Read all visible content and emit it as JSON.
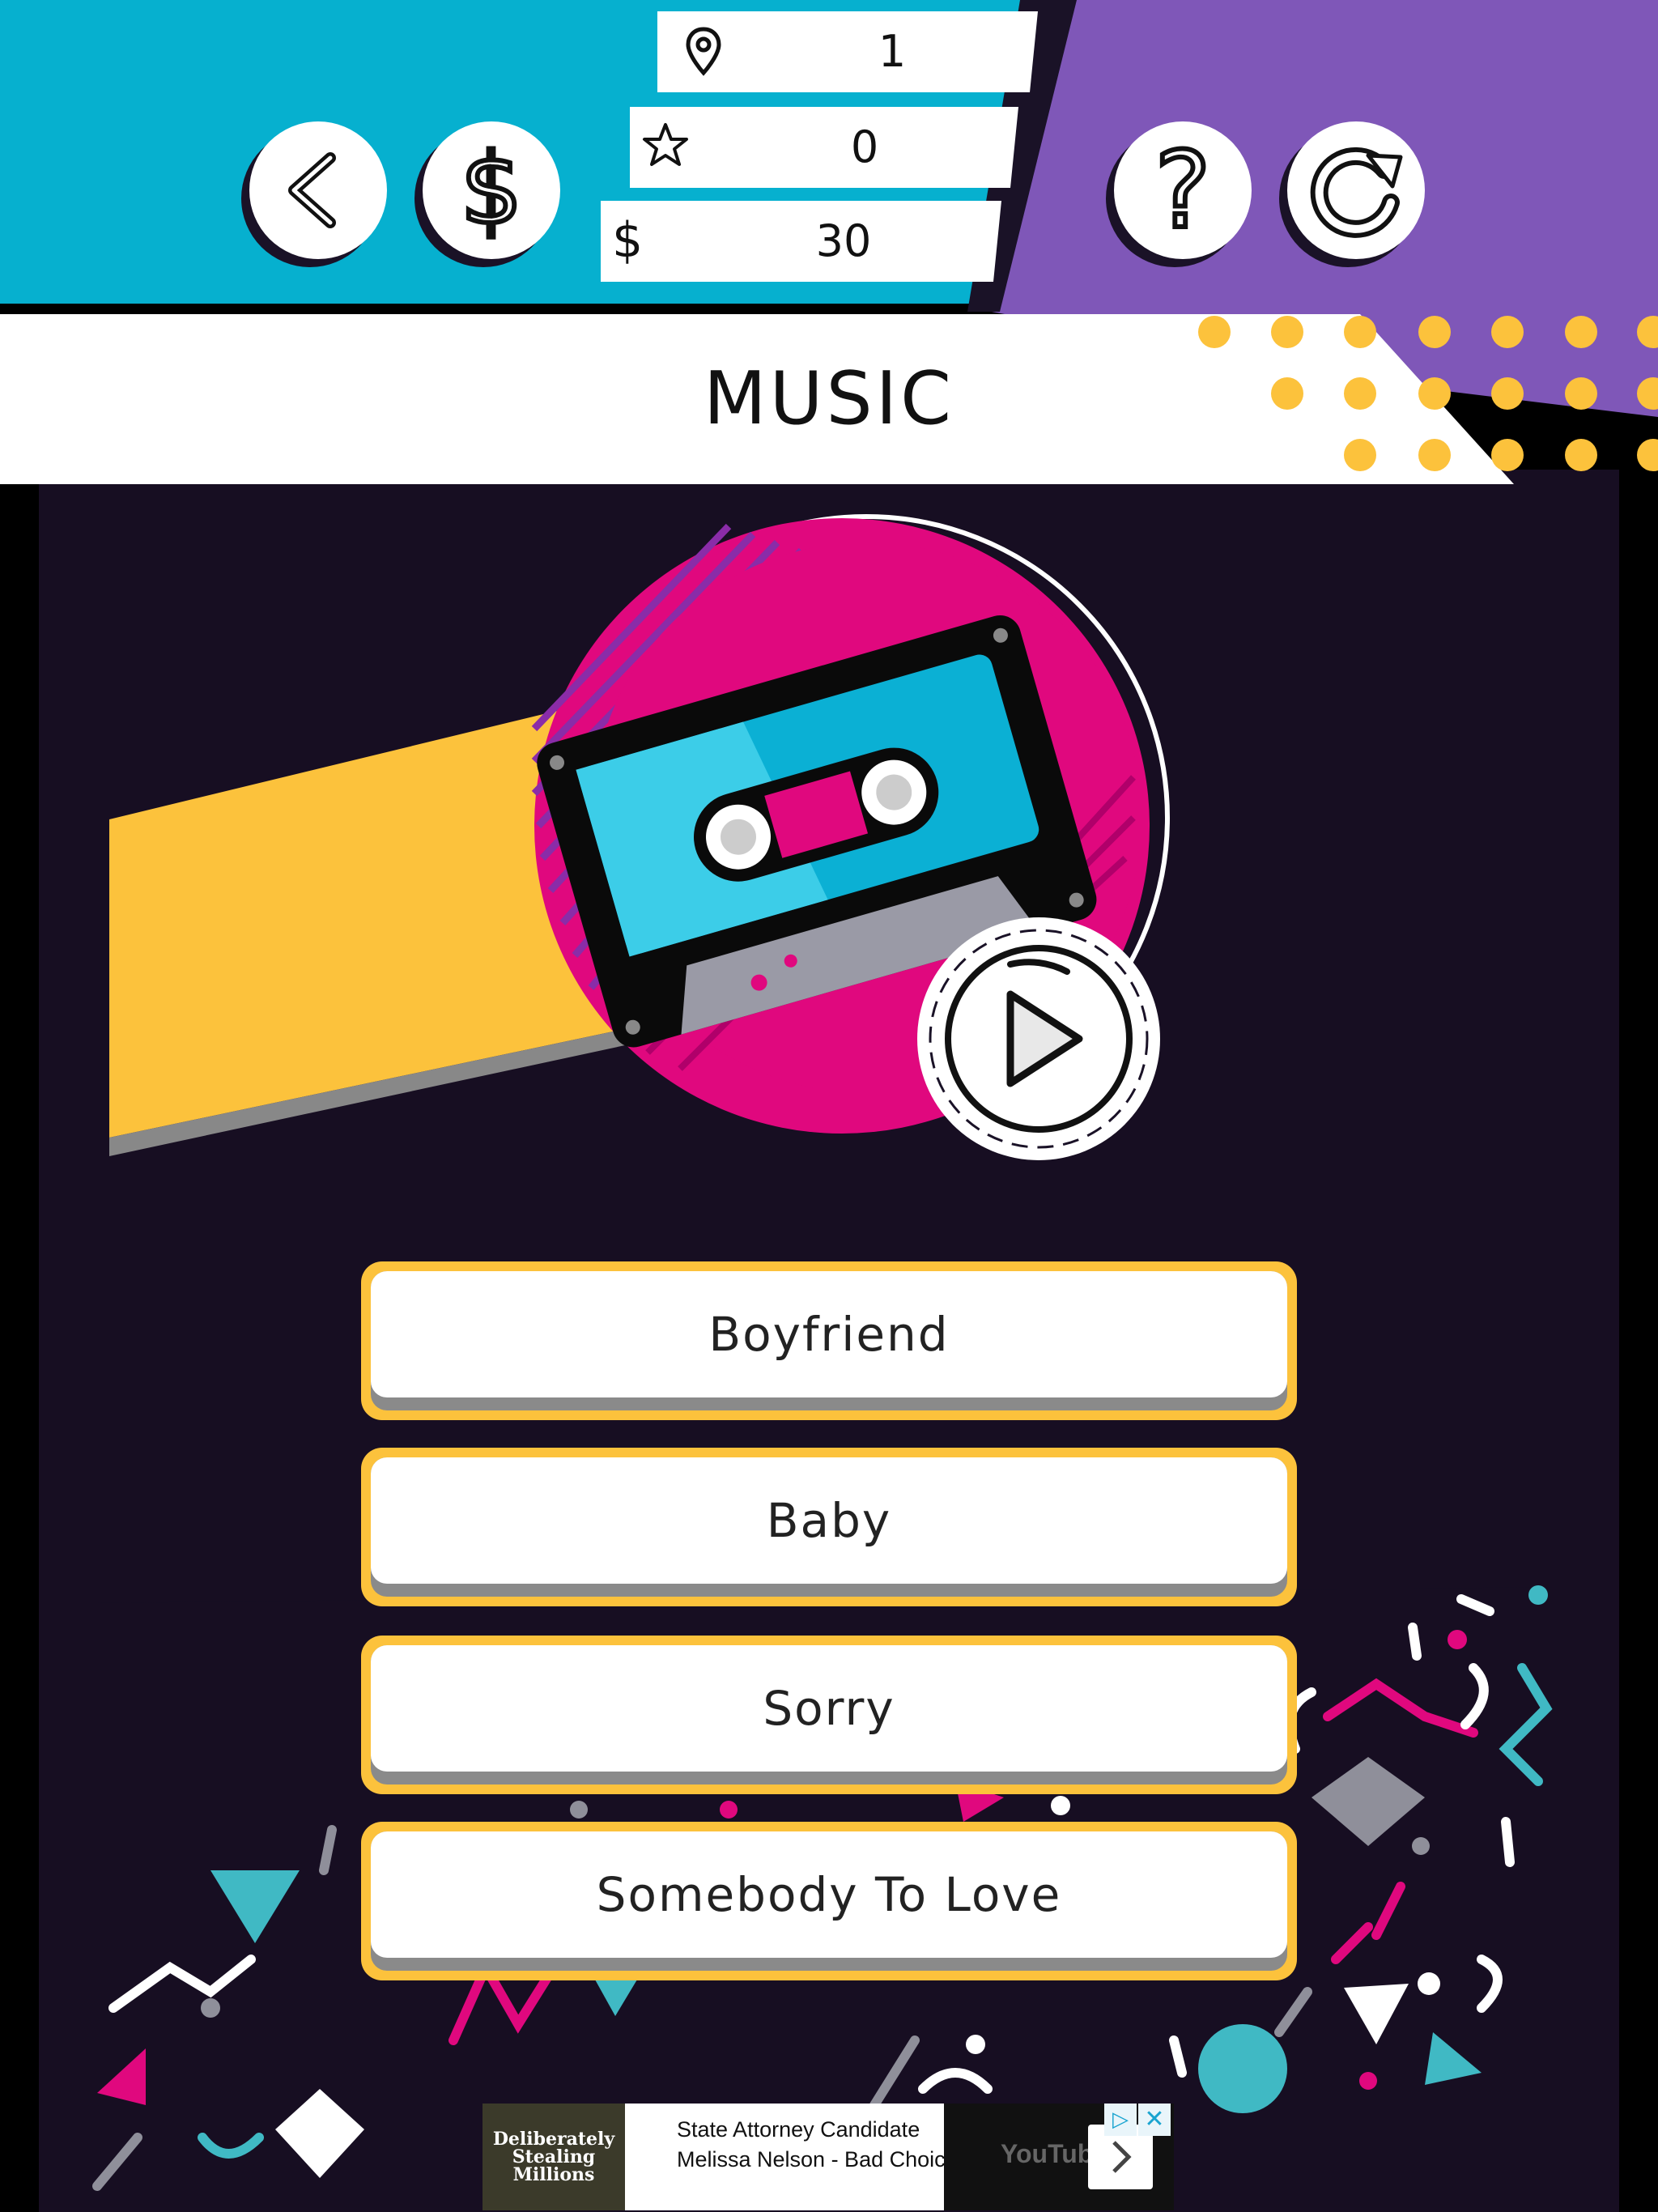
{
  "stats": {
    "level": "1",
    "stars": "0",
    "coins": "30"
  },
  "category": {
    "title": "MUSIC"
  },
  "answers": [
    {
      "label": "Boyfriend"
    },
    {
      "label": "Baby"
    },
    {
      "label": "Sorry"
    },
    {
      "label": "Somebody To Love"
    }
  ],
  "ad": {
    "thumbnail_text": "Deliberately Stealing Millions",
    "headline": "State Attorney Candidate Melissa Nelson - Bad Choices",
    "video_brand": "YouTube"
  },
  "colors": {
    "header_cyan": "#06b0cf",
    "header_purple": "#7f57b8",
    "background_dark": "#170e22",
    "accent_yellow": "#fcc23c",
    "accent_pink": "#e0087e",
    "cassette_blue": "#0bb0d4"
  },
  "icons": {
    "back": "chevron-left-icon",
    "shop": "dollar-icon",
    "hint": "question-icon",
    "restart": "restart-icon",
    "level": "map-pin-icon",
    "stars": "star-icon",
    "coins": "dollar-icon",
    "play": "play-icon"
  }
}
